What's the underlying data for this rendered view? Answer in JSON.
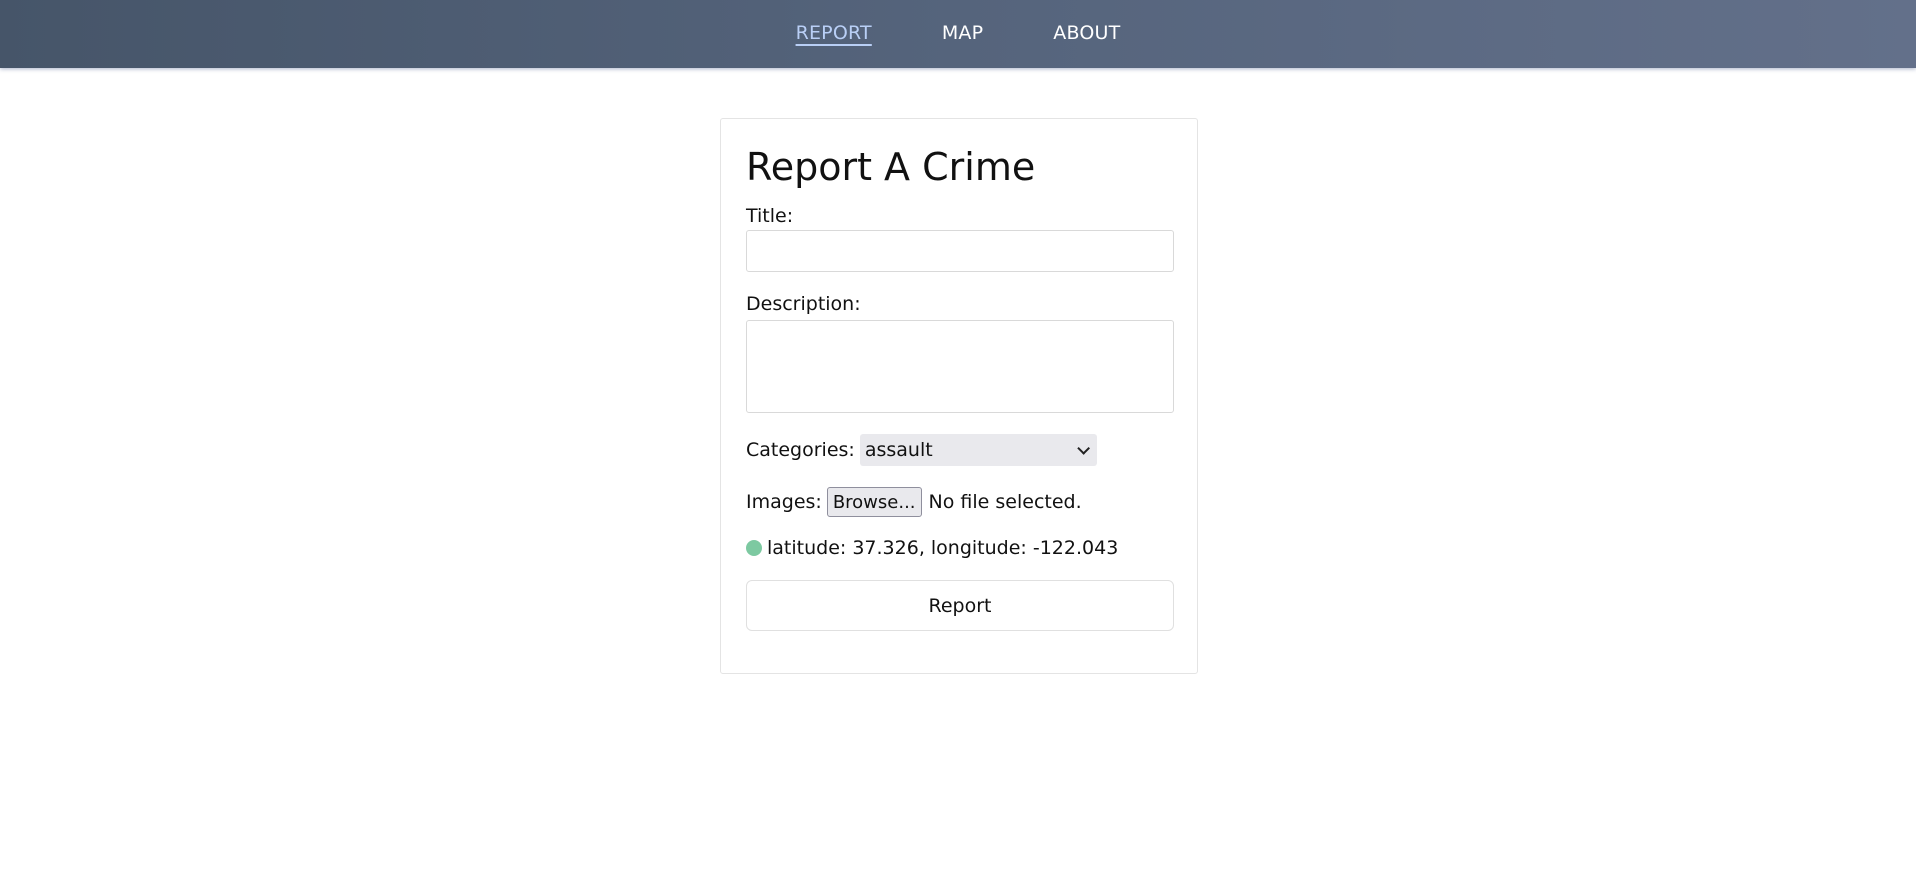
{
  "nav": {
    "items": [
      {
        "label": "REPORT",
        "active": true
      },
      {
        "label": "MAP",
        "active": false
      },
      {
        "label": "ABOUT",
        "active": false
      }
    ]
  },
  "form": {
    "heading": "Report A Crime",
    "title_label": "Title:",
    "title_value": "",
    "description_label": "Description:",
    "description_value": "",
    "categories_label": "Categories:",
    "categories_selected": "assault",
    "images_label": "Images:",
    "browse_label": "Browse...",
    "file_status": "No file selected.",
    "location_text": "latitude: 37.326, longitude: -122.043",
    "location_indicator_color": "#7dc9a1",
    "submit_label": "Report"
  },
  "colors": {
    "active_nav": "#b9cff6",
    "nav_bg_start": "#465569",
    "nav_bg_end": "#63708a"
  }
}
